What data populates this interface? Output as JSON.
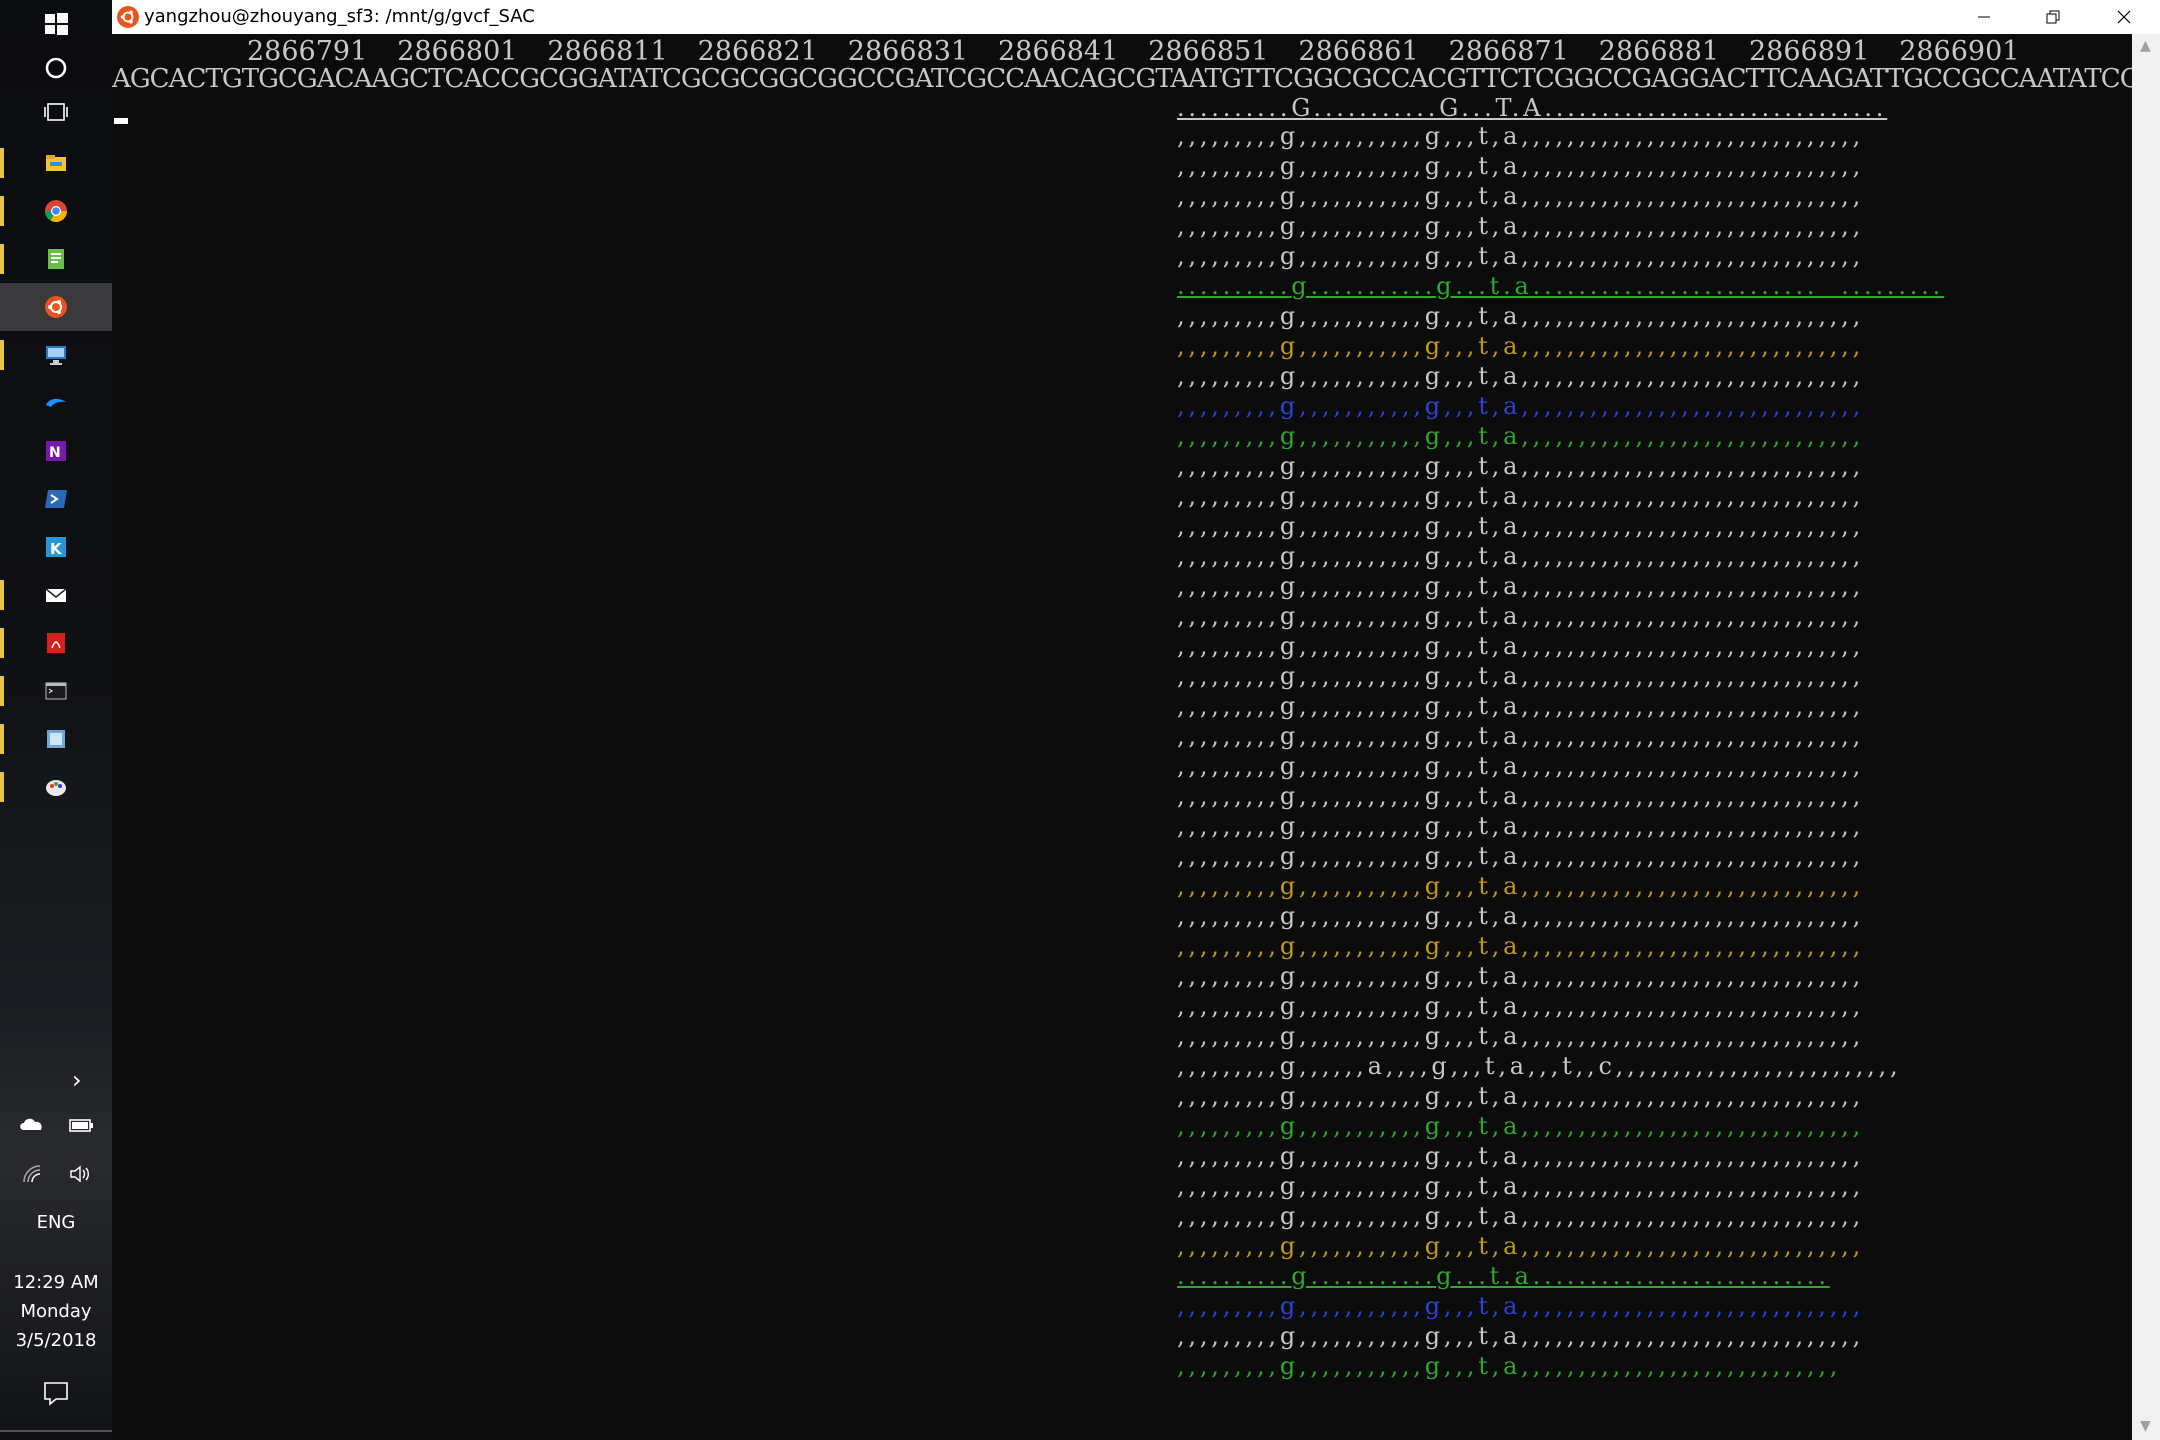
{
  "window": {
    "title": "yangzhou@zhouyang_sf3: /mnt/g/gvcf_SAC",
    "minimize_icon": "minimize-icon",
    "restore_icon": "restore-icon",
    "close_icon": "close-icon"
  },
  "taskbar": {
    "apps": [
      "windows-start-icon",
      "cortana-icon",
      "task-view-icon",
      "file-explorer-icon",
      "chrome-icon",
      "notepad-icon",
      "ubuntu-icon",
      "remote-desktop-icon",
      "edge-icon",
      "onenote-icon",
      "powershell-icon",
      "app-icon",
      "mail-icon",
      "acrobat-icon",
      "terminal-icon",
      "image-viewer-icon",
      "paint-icon"
    ],
    "tray": {
      "chevron": "show-hidden-icons-chevron",
      "language": "ENG",
      "time": "12:29 AM",
      "day": "Monday",
      "date": "3/5/2018"
    }
  },
  "terminal": {
    "positions": [
      "2866791",
      "2866801",
      "2866811",
      "2866821",
      "2866831",
      "2866841",
      "2866851",
      "2866861",
      "2866871",
      "2866881",
      "2866891",
      "2866901"
    ],
    "reference": "AGCACTGTGCGACAAGCTCACCGCGGATATCGCGCGGCGGCCGATCGCCAACAGCGTAATGTTCGGCGCCACGTTCTCGGCCGAGGACTTCAAGATTGCCGCCAATATCGTGCGGGAGGAAGCCGCCAAGTACG",
    "consensus": "..........G...........G...T.A..............................",
    "reads": [
      {
        "text": ",,,,,,,,,g,,,,,,,,,,,g,,,t,a,,,,,,,,,,,,,,,,,,,,,,,,,,,,,,",
        "color": "default"
      },
      {
        "text": ",,,,,,,,,g,,,,,,,,,,,g,,,t,a,,,,,,,,,,,,,,,,,,,,,,,,,,,,,,",
        "color": "default"
      },
      {
        "text": ",,,,,,,,,g,,,,,,,,,,,g,,,t,a,,,,,,,,,,,,,,,,,,,,,,,,,,,,,,",
        "color": "default"
      },
      {
        "text": ",,,,,,,,,g,,,,,,,,,,,g,,,t,a,,,,,,,,,,,,,,,,,,,,,,,,,,,,,,",
        "color": "default"
      },
      {
        "text": ",,,,,,,,,g,,,,,,,,,,,g,,,t,a,,,,,,,,,,,,,,,,,,,,,,,,,,,,,,",
        "color": "default"
      },
      {
        "text": "..........g...........g...t.a.........................  .........",
        "color": "green-mixed"
      },
      {
        "text": ",,,,,,,,,g,,,,,,,,,,,g,,,t,a,,,,,,,,,,,,,,,,,,,,,,,,,,,,,,",
        "color": "default"
      },
      {
        "text": ",,,,,,,,,g,,,,,,,,,,,g,,,t,a,,,,,,,,,,,,,,,,,,,,,,,,,,,,,,",
        "color": "yellow"
      },
      {
        "text": ",,,,,,,,,g,,,,,,,,,,,g,,,t,a,,,,,,,,,,,,,,,,,,,,,,,,,,,,,,",
        "color": "default"
      },
      {
        "text": ",,,,,,,,,g,,,,,,,,,,,g,,,t,a,,,,,,,,,,,,,,,,,,,,,,,,,,,,,,",
        "color": "blue"
      },
      {
        "text": ",,,,,,,,,g,,,,,,,,,,,g,,,t,a,,,,,,,,,,,,,,,,,,,,,,,,,,,,,,",
        "color": "green"
      },
      {
        "text": ",,,,,,,,,g,,,,,,,,,,,g,,,t,a,,,,,,,,,,,,,,,,,,,,,,,,,,,,,,",
        "color": "default"
      },
      {
        "text": ",,,,,,,,,g,,,,,,,,,,,g,,,t,a,,,,,,,,,,,,,,,,,,,,,,,,,,,,,,",
        "color": "default"
      },
      {
        "text": ",,,,,,,,,g,,,,,,,,,,,g,,,t,a,,,,,,,,,,,,,,,,,,,,,,,,,,,,,,",
        "color": "default"
      },
      {
        "text": ",,,,,,,,,g,,,,,,,,,,,g,,,t,a,,,,,,,,,,,,,,,,,,,,,,,,,,,,,,",
        "color": "default"
      },
      {
        "text": ",,,,,,,,,g,,,,,,,,,,,g,,,t,a,,,,,,,,,,,,,,,,,,,,,,,,,,,,,,",
        "color": "default"
      },
      {
        "text": ",,,,,,,,,g,,,,,,,,,,,g,,,t,a,,,,,,,,,,,,,,,,,,,,,,,,,,,,,,",
        "color": "default"
      },
      {
        "text": ",,,,,,,,,g,,,,,,,,,,,g,,,t,a,,,,,,,,,,,,,,,,,,,,,,,,,,,,,,",
        "color": "default"
      },
      {
        "text": ",,,,,,,,,g,,,,,,,,,,,g,,,t,a,,,,,,,,,,,,,,,,,,,,,,,,,,,,,,",
        "color": "default"
      },
      {
        "text": ",,,,,,,,,g,,,,,,,,,,,g,,,t,a,,,,,,,,,,,,,,,,,,,,,,,,,,,,,,",
        "color": "default"
      },
      {
        "text": ",,,,,,,,,g,,,,,,,,,,,g,,,t,a,,,,,,,,,,,,,,,,,,,,,,,,,,,,,,",
        "color": "default"
      },
      {
        "text": ",,,,,,,,,g,,,,,,,,,,,g,,,t,a,,,,,,,,,,,,,,,,,,,,,,,,,,,,,,",
        "color": "default"
      },
      {
        "text": ",,,,,,,,,g,,,,,,,,,,,g,,,t,a,,,,,,,,,,,,,,,,,,,,,,,,,,,,,,",
        "color": "default"
      },
      {
        "text": ",,,,,,,,,g,,,,,,,,,,,g,,,t,a,,,,,,,,,,,,,,,,,,,,,,,,,,,,,,",
        "color": "default"
      },
      {
        "text": ",,,,,,,,,g,,,,,,,,,,,g,,,t,a,,,,,,,,,,,,,,,,,,,,,,,,,,,,,,",
        "color": "default"
      },
      {
        "text": ",,,,,,,,,g,,,,,,,,,,,g,,,t,a,,,,,,,,,,,,,,,,,,,,,,,,,,,,,,",
        "color": "yellow"
      },
      {
        "text": ",,,,,,,,,g,,,,,,,,,,,g,,,t,a,,,,,,,,,,,,,,,,,,,,,,,,,,,,,,",
        "color": "default"
      },
      {
        "text": ",,,,,,,,,g,,,,,,,,,,,g,,,t,a,,,,,,,,,,,,,,,,,,,,,,,,,,,,,,",
        "color": "yellow"
      },
      {
        "text": ",,,,,,,,,g,,,,,,,,,,,g,,,t,a,,,,,,,,,,,,,,,,,,,,,,,,,,,,,,",
        "color": "default"
      },
      {
        "text": ",,,,,,,,,g,,,,,,,,,,,g,,,t,a,,,,,,,,,,,,,,,,,,,,,,,,,,,,,,",
        "color": "default"
      },
      {
        "text": ",,,,,,,,,g,,,,,,,,,,,g,,,t,a,,,,,,,,,,,,,,,,,,,,,,,,,,,,,,",
        "color": "default"
      },
      {
        "text": ",,,,,,,,,g,,,,,,a,,,,g,,,t,a,,,t,,c,,,,,,,,,,,,,,,,,,,,,,,,,",
        "color": "default"
      },
      {
        "text": ",,,,,,,,,g,,,,,,,,,,,g,,,t,a,,,,,,,,,,,,,,,,,,,,,,,,,,,,,,",
        "color": "default"
      },
      {
        "text": ",,,,,,,,,g,,,,,,,,,,,g,,,t,a,,,,,,,,,,,,,,,,,,,,,,,,,,,,,,",
        "color": "green"
      },
      {
        "text": ",,,,,,,,,g,,,,,,,,,,,g,,,t,a,,,,,,,,,,,,,,,,,,,,,,,,,,,,,,",
        "color": "default"
      },
      {
        "text": ",,,,,,,,,g,,,,,,,,,,,g,,,t,a,,,,,,,,,,,,,,,,,,,,,,,,,,,,,,",
        "color": "default"
      },
      {
        "text": ",,,,,,,,,g,,,,,,,,,,,g,,,t,a,,,,,,,,,,,,,,,,,,,,,,,,,,,,,,",
        "color": "default"
      },
      {
        "text": ",,,,,,,,,g,,,,,,,,,,,g,,,t,a,,,,,,,,,,,,,,,,,,,,,,,,,,,,,,",
        "color": "yellow"
      },
      {
        "text": "..........g...........g...t.a..........................",
        "color": "green"
      },
      {
        "text": ",,,,,,,,,g,,,,,,,,,,,g,,,t,a,,,,,,,,,,,,,,,,,,,,,,,,,,,,,,",
        "color": "blue"
      },
      {
        "text": ",,,,,,,,,g,,,,,,,,,,,g,,,t,a,,,,,,,,,,,,,,,,,,,,,,,,,,,,,,",
        "color": "default"
      },
      {
        "text": ",,,,,,,,,g,,,,,,,,,,,g,,,t,a,,,,,,,,,,,,,,,,,,,,,,,,,,,,",
        "color": "green"
      }
    ]
  },
  "colors": {
    "default": "#c8c8c8",
    "green": "#2fa82f",
    "yellow": "#c29a17",
    "blue": "#2b43d8",
    "taskbar_pin": "#e8c34a"
  }
}
